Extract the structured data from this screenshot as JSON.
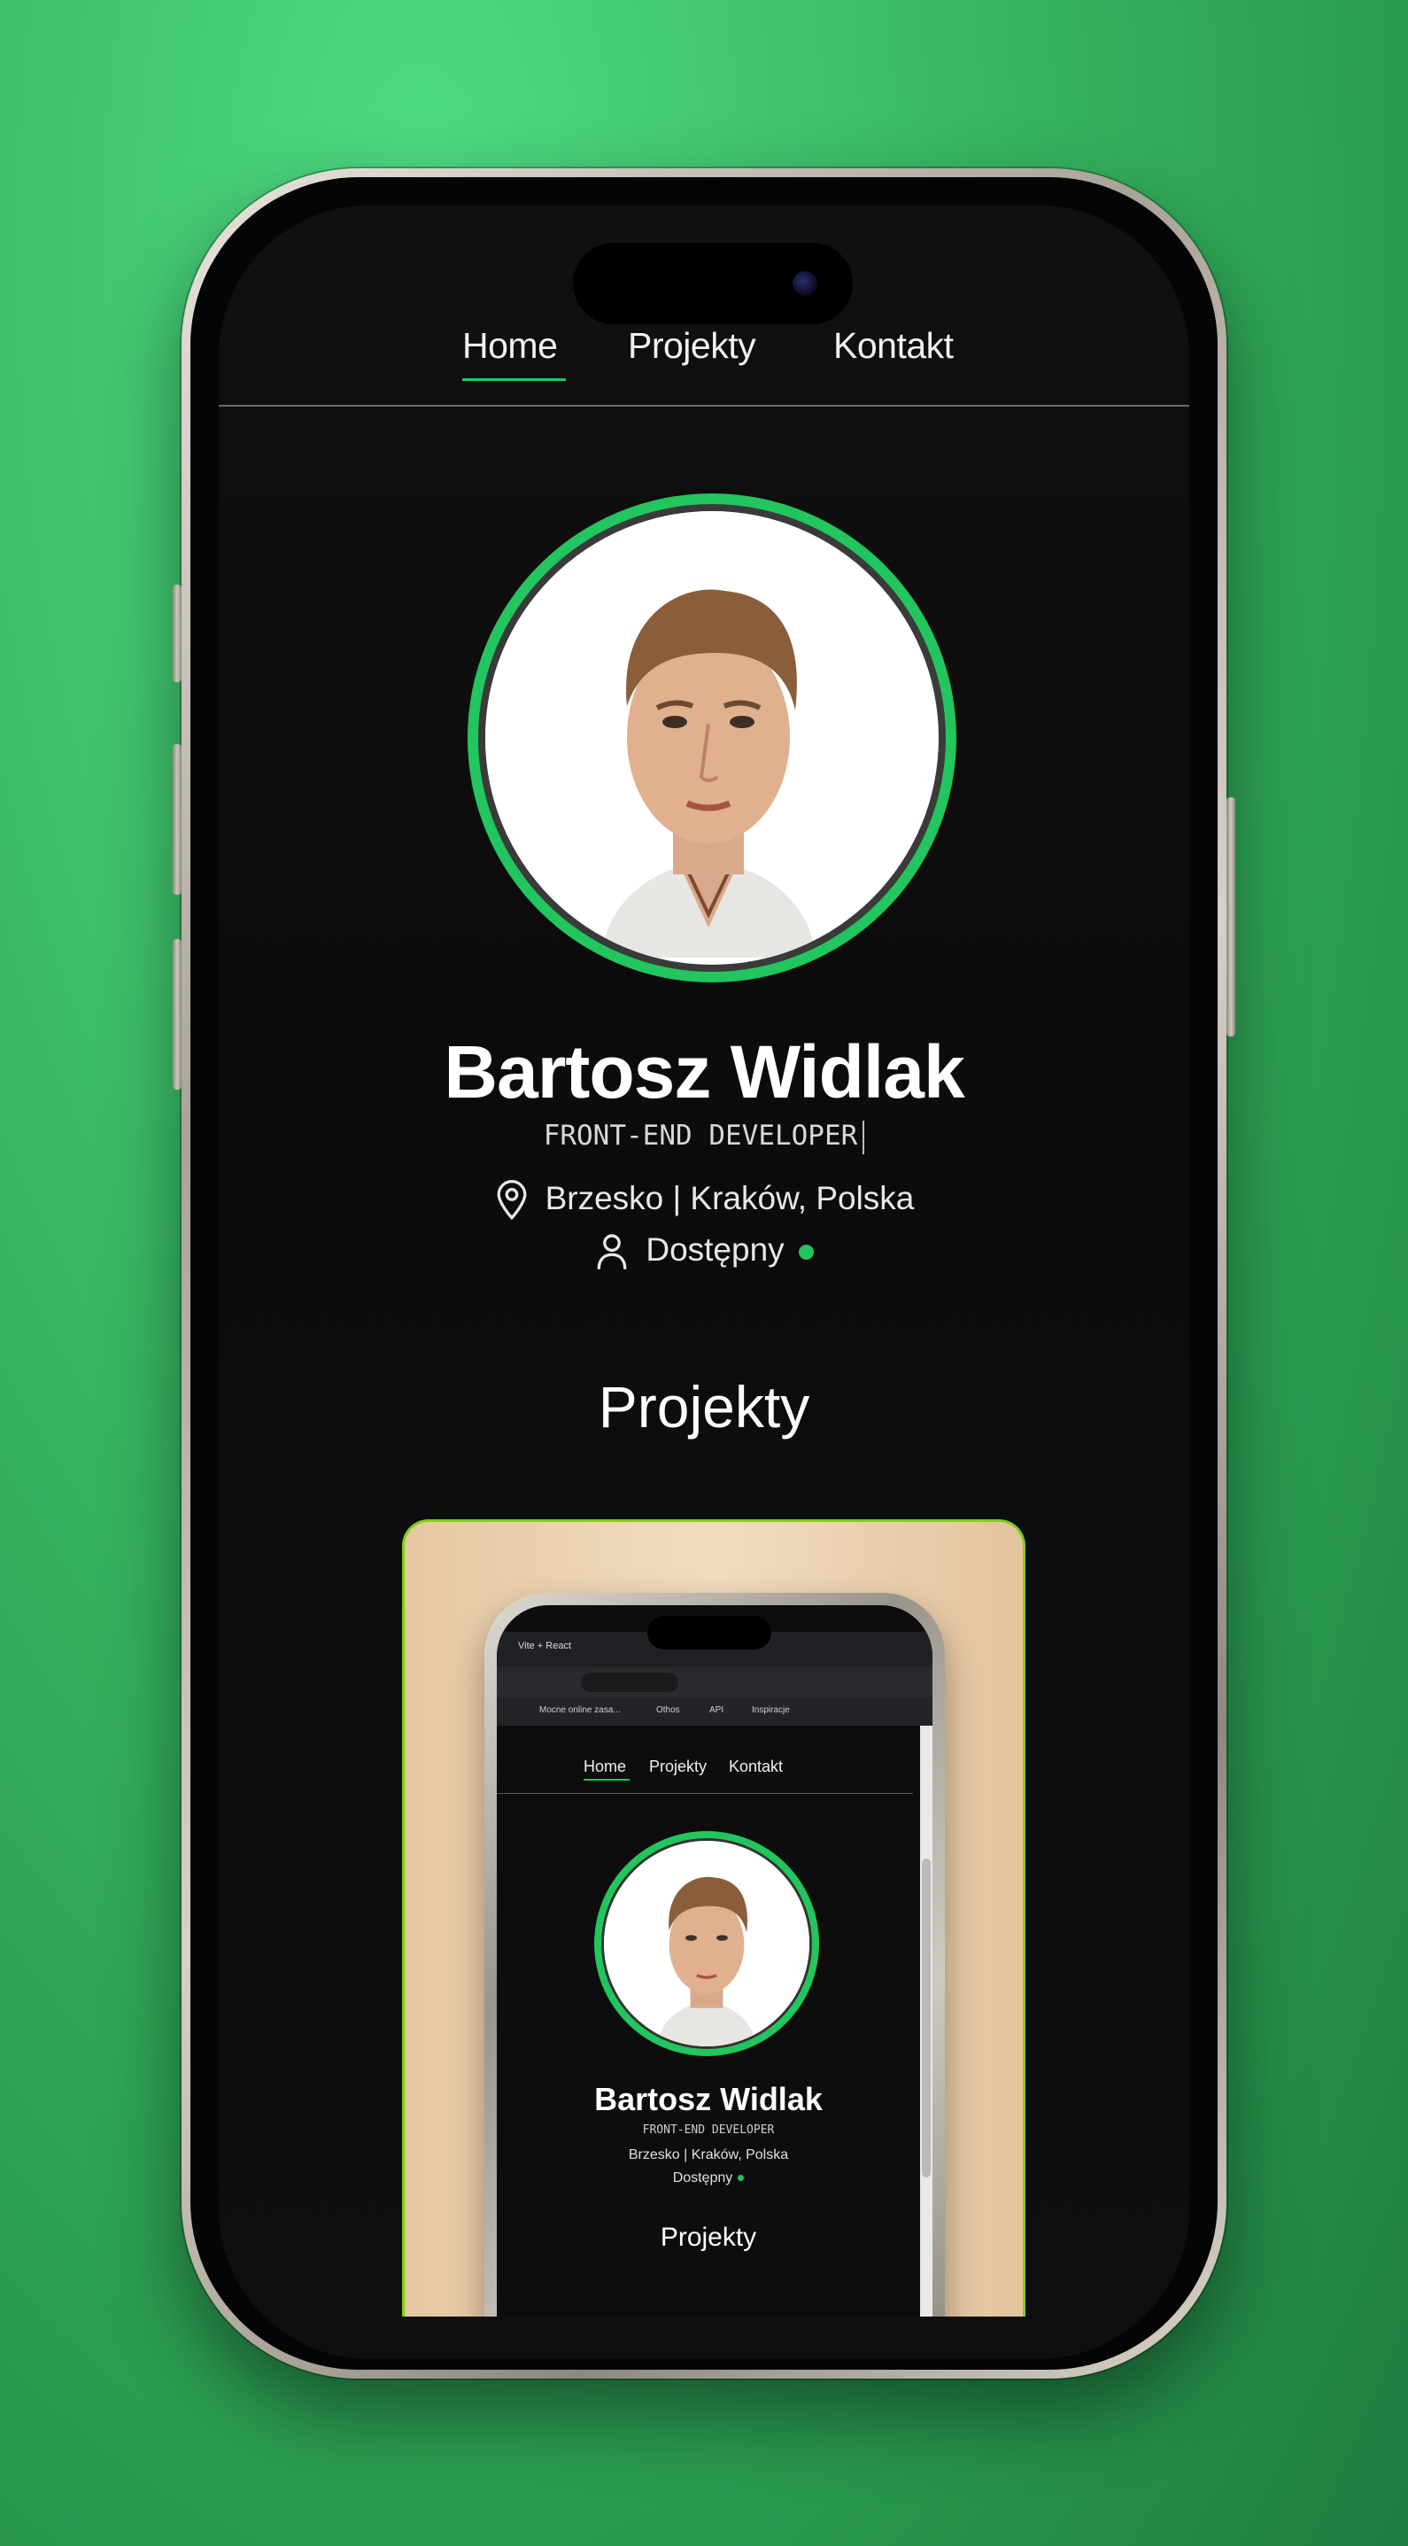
{
  "nav": {
    "items": [
      {
        "label": "Home",
        "active": true
      },
      {
        "label": "Projekty",
        "active": false
      },
      {
        "label": "Kontakt",
        "active": false
      }
    ]
  },
  "profile": {
    "name": "Bartosz Widlak",
    "role": "FRONT-END DEVELOPER",
    "location": "Brzesko | Kraków, Polska",
    "availability": "Dostępny",
    "availability_color": "#22c55e"
  },
  "projects": {
    "title": "Projekty"
  },
  "preview": {
    "browser_tab": "Vite + React",
    "bookmarks": [
      "Mocne online zasa...",
      "Othos",
      "API",
      "Inspiracje"
    ],
    "nav": [
      "Home",
      "Projekty",
      "Kontakt"
    ],
    "name": "Bartosz Widlak",
    "role": "FRONT-END DEVELOPER",
    "location": "Brzesko | Kraków, Polska",
    "availability": "Dostępny",
    "section": "Projekty"
  },
  "colors": {
    "accent": "#22c55e",
    "card_border": "#84cc16",
    "background": "#37b862"
  }
}
